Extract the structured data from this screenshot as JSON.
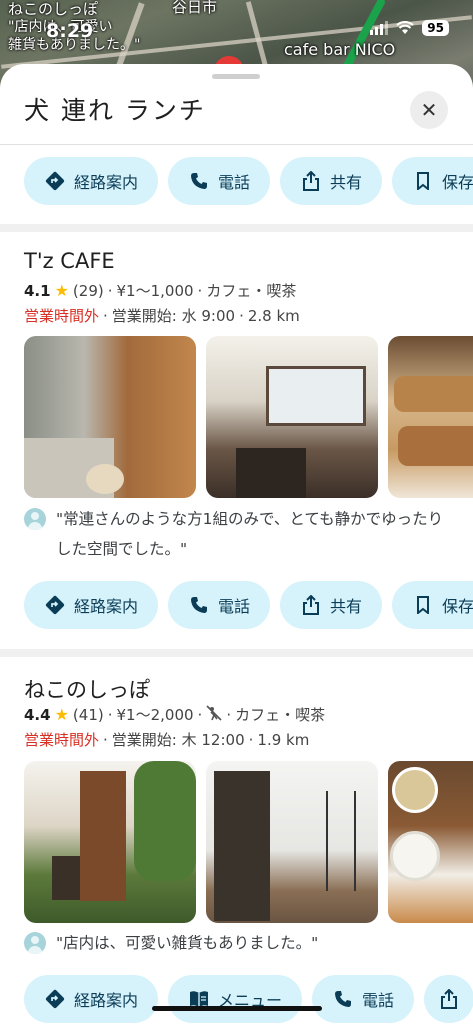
{
  "status_bar": {
    "time": "8:29",
    "battery": "95"
  },
  "map": {
    "labels": [
      "ねこのしっぽ",
      "\"店内は、可愛い",
      "雑貨もありました。\"",
      "谷日市",
      "cafe bar NICO"
    ]
  },
  "search": {
    "title": "犬 連れ ランチ",
    "close_label": "✕"
  },
  "top_actions": [
    {
      "label": "経路案内",
      "icon": "directions-icon"
    },
    {
      "label": "電話",
      "icon": "phone-icon"
    },
    {
      "label": "共有",
      "icon": "share-icon"
    },
    {
      "label": "保存",
      "icon": "bookmark-icon"
    }
  ],
  "places": [
    {
      "name": "T'z CAFE",
      "rating": "4.1",
      "reviews": "(29)",
      "price": "¥1～1,000",
      "category": "カフェ・喫茶",
      "status": "営業時間外",
      "opens": "営業開始: 水 9:00",
      "distance": "2.8 km",
      "review": "\"常連さんのような方1組のみで、とても静かでゆったりした空間でした。\"",
      "actions": [
        {
          "label": "経路案内",
          "icon": "directions-icon"
        },
        {
          "label": "電話",
          "icon": "phone-icon"
        },
        {
          "label": "共有",
          "icon": "share-icon"
        },
        {
          "label": "保存",
          "icon": "bookmark-icon"
        }
      ]
    },
    {
      "name": "ねこのしっぽ",
      "rating": "4.4",
      "reviews": "(41)",
      "price": "¥1～2,000",
      "category": "カフェ・喫茶",
      "status": "営業時間外",
      "opens": "営業開始: 木 12:00",
      "distance": "1.9 km",
      "review": "\"店内は、可愛い雑貨もありました。\"",
      "actions": [
        {
          "label": "経路案内",
          "icon": "directions-icon"
        },
        {
          "label": "メニュー",
          "icon": "menu-book-icon"
        },
        {
          "label": "電話",
          "icon": "phone-icon"
        }
      ]
    }
  ],
  "colors": {
    "chip_bg": "#d6f2fb",
    "chip_text": "#0b3d57",
    "closed": "#d93025",
    "star": "#fbbc04"
  }
}
